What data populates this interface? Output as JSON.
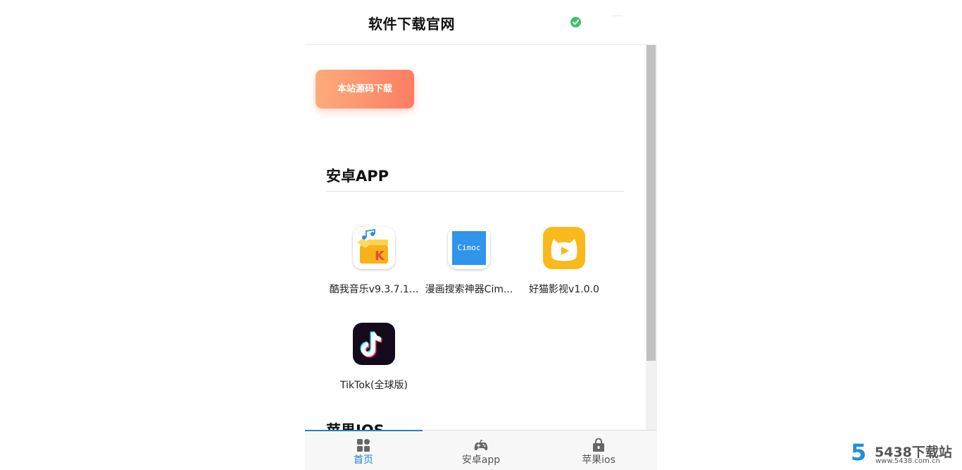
{
  "header": {
    "title": "软件下载官网",
    "verified_icon": "check-circle-icon",
    "verified_color": "#3ec266"
  },
  "source_button": {
    "label": "本站源码下载"
  },
  "sections": {
    "android": {
      "title": "安卓APP"
    },
    "ios": {
      "title": "苹果IOS"
    }
  },
  "apps": [
    {
      "name": "酷我音乐v9.3.7.1...",
      "icon": "kuwo-music-icon"
    },
    {
      "name": "漫画搜索神器Cim...",
      "icon": "cimoc-icon",
      "icon_text": "Cimoc"
    },
    {
      "name": "好猫影视v1.0.0",
      "icon": "haomao-video-icon"
    },
    {
      "name": "TikTok(全球版)",
      "icon": "tiktok-icon"
    }
  ],
  "tabs": [
    {
      "label": "首页",
      "icon": "home-grid-icon",
      "active": true
    },
    {
      "label": "安卓app",
      "icon": "gamepad-icon",
      "active": false
    },
    {
      "label": "苹果ios",
      "icon": "lock-box-icon",
      "active": false
    }
  ],
  "watermark": {
    "logo": "5",
    "name": "5438下载站",
    "url": "www.5438.com.cn"
  },
  "colors": {
    "accent": "#1c80d6",
    "button_gradient_start": "#fdab7b",
    "button_gradient_end": "#fd7d63"
  }
}
